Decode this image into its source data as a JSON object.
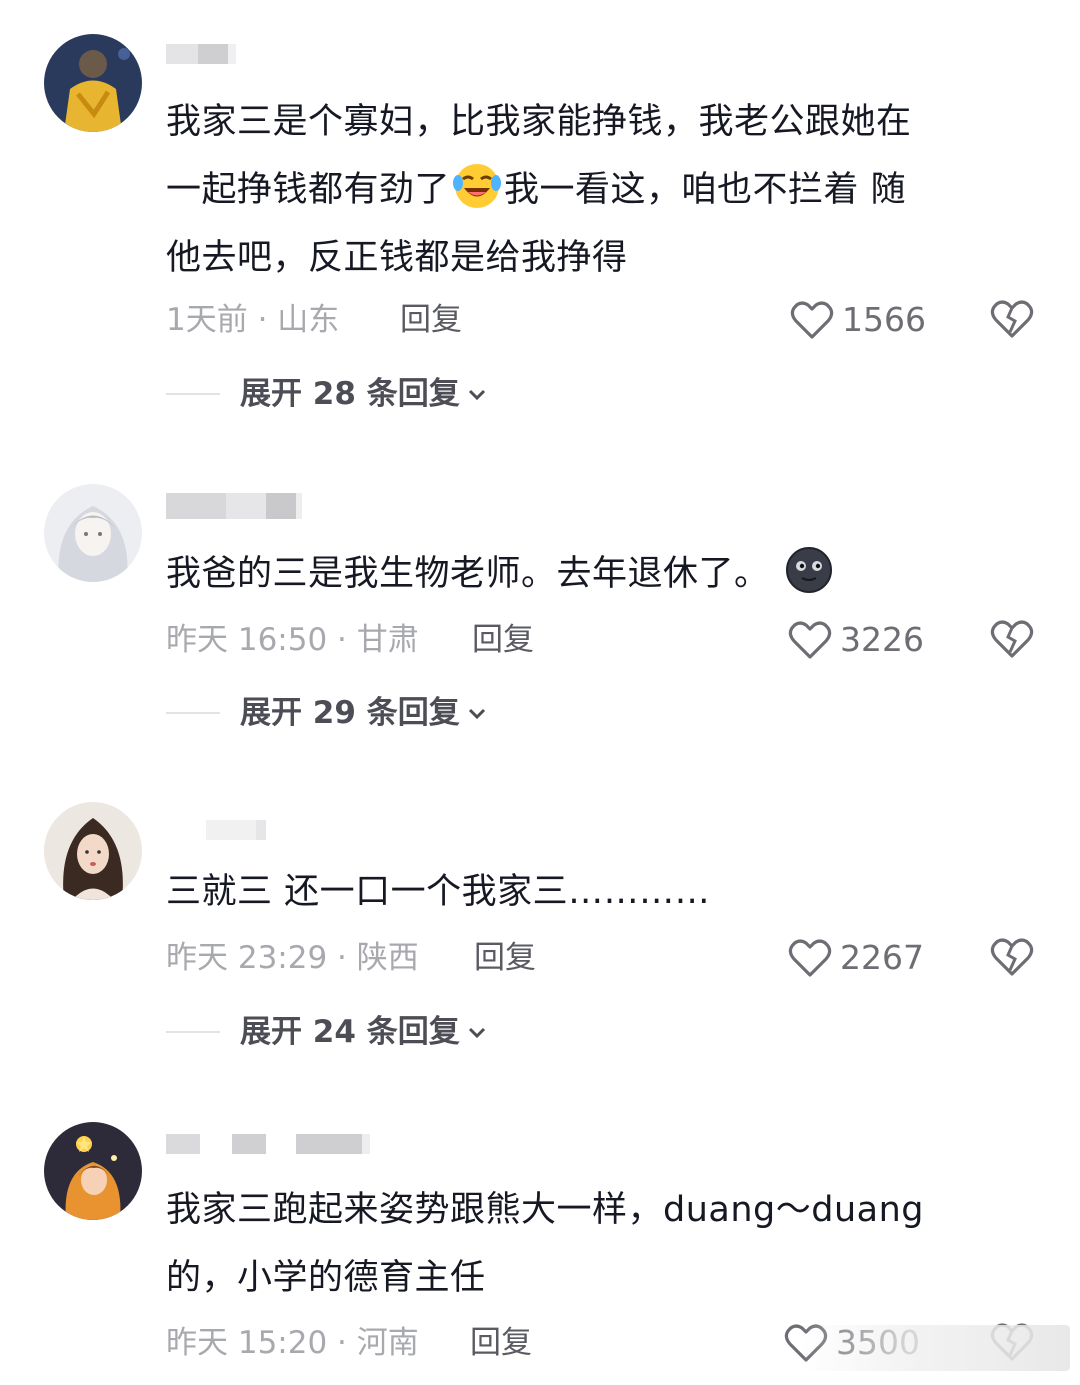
{
  "comments": [
    {
      "text_lines": [
        "我家三是个寡妇，比我家能挣钱，我老公跟她在",
        "一起挣钱都有劲了",
        "我一看这，咱也不拦着 随",
        "他去吧，反正钱都是给我挣得"
      ],
      "emoji": "laughing-crying-emoji",
      "meta": "1天前 · 山东",
      "reply": "回复",
      "likes": "1566",
      "expand": "展开 28 条回复"
    },
    {
      "text_lines": [
        "我爸的三是我生物老师。去年退休了。"
      ],
      "emoji": "new-moon-face-emoji",
      "meta": "昨天 16:50 · 甘肃",
      "reply": "回复",
      "likes": "3226",
      "expand": "展开 29 条回复"
    },
    {
      "text_lines": [
        "三就三 还一口一个我家三…………"
      ],
      "meta": "昨天 23:29 · 陕西",
      "reply": "回复",
      "likes": "2267",
      "expand": "展开 24 条回复"
    },
    {
      "text_lines": [
        "我家三跑起来姿势跟熊大一样，duang～duang",
        "的，小学的德育主任"
      ],
      "meta": "昨天 15:20 · 河南",
      "reply": "回复",
      "likes": "3500"
    }
  ],
  "colors": {
    "text": "#161823",
    "meta": "#a8a9ae",
    "icon": "#6d6e74"
  }
}
